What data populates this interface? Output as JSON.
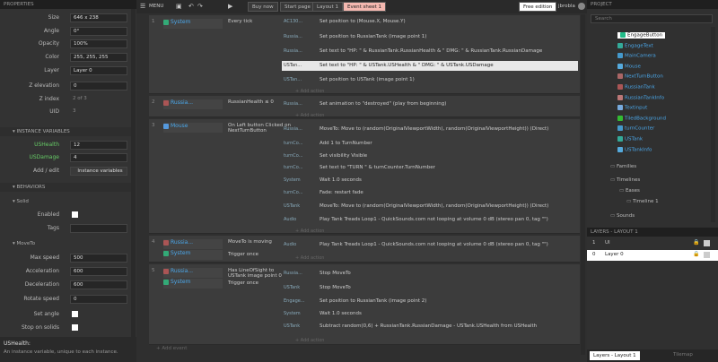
{
  "properties": {
    "header": "PROPERTIES",
    "rows": [
      {
        "label": "Size",
        "value": "646 x 238"
      },
      {
        "label": "Angle",
        "value": "0°"
      },
      {
        "label": "Opacity",
        "value": "100%"
      },
      {
        "label": "Color",
        "value": "255, 255, 255"
      },
      {
        "label": "Layer",
        "value": "Layer 0"
      },
      {
        "label": "Z elevation",
        "value": "0"
      },
      {
        "label": "Z index",
        "value": "2 of 3"
      },
      {
        "label": "UID",
        "value": "3"
      }
    ],
    "instance_vars_header": "INSTANCE VARIABLES",
    "instance_vars": [
      {
        "label": "USHealth",
        "value": "12"
      },
      {
        "label": "USDamage",
        "value": "4"
      }
    ],
    "add_edit_label": "Add / edit",
    "instance_vars_button": "Instance variables",
    "behaviors_header": "BEHAVIORS",
    "solid_label": "Solid",
    "enabled_label": "Enabled",
    "tags_label": "Tags",
    "moveto_label": "MoveTo",
    "moveto_rows": [
      {
        "label": "Max speed",
        "value": "500"
      },
      {
        "label": "Acceleration",
        "value": "600"
      },
      {
        "label": "Deceleration",
        "value": "600"
      },
      {
        "label": "Rotate speed",
        "value": "0"
      }
    ],
    "set_angle_label": "Set angle",
    "stop_on_solids_label": "Stop on solids",
    "help_title": "USHealth:",
    "help_text": "An instance variable, unique to each instance."
  },
  "toolbar": {
    "menu": "MENU",
    "buy_now": "Buy now",
    "start_page": "Start page",
    "layout_tab": "Layout 1",
    "event_tab": "Event sheet 1",
    "free_edition": "Free edition",
    "user": "jbrobla"
  },
  "events": [
    {
      "num": "1",
      "obj": "System",
      "cond": "Every tick",
      "actions": [
        {
          "obj": "AC130...",
          "text": "Set position to (Mouse.X, Mouse.Y)"
        },
        {
          "obj": "Russia...",
          "text": "Set position to RussianTank (image point 1)"
        },
        {
          "obj": "Russia...",
          "text": "Set text to \"HP: \" & RussianTank.RussianHealth & \" DMG: \" & RussianTank.RussianDamage"
        },
        {
          "obj": "USTan...",
          "text": "Set text to \"HP: \" & USTank.USHealth & \" DMG: \" & USTank.USDamage"
        },
        {
          "obj": "USTan...",
          "text": "Set position to USTank (image point 1)"
        }
      ]
    },
    {
      "num": "2",
      "obj": "Russia...",
      "cond": "RussianHealth ≤ 0",
      "actions": [
        {
          "obj": "Russia...",
          "text": "Set animation to \"destroyed\" (play from beginning)"
        }
      ]
    },
    {
      "num": "3",
      "obj": "Mouse",
      "cond": "On Left button Clicked on NextTurnButton",
      "actions": [
        {
          "obj": "Russia...",
          "text": "MoveTo: Move to (random(OriginalViewportWidth), random(OriginalViewportHeight)) (Direct)"
        },
        {
          "obj": "turnCo...",
          "text": "Add 1 to TurnNumber"
        },
        {
          "obj": "turnCo...",
          "text": "Set visibility Visible"
        },
        {
          "obj": "turnCo...",
          "text": "Set text to \"TURN \" & turnCounter.TurnNumber"
        },
        {
          "obj": "System",
          "text": "Wait 1.0 seconds"
        },
        {
          "obj": "turnCo...",
          "text": "Fade: restart fade"
        },
        {
          "obj": "USTank",
          "text": "MoveTo: Move to (random(OriginalViewportWidth), random(OriginalViewportHeight)) (Direct)"
        },
        {
          "obj": "Audio",
          "text": "Play Tank Treads Loop1 - QuickSounds.com not looping at volume 0 dB (stereo pan 0, tag \"\")"
        }
      ]
    },
    {
      "num": "4",
      "obj": "Russia...",
      "cond": "MoveTo is moving",
      "obj2": "System",
      "cond2": "Trigger once",
      "actions": [
        {
          "obj": "Audio",
          "text": "Play Tank Treads Loop1 - QuickSounds.com not looping at volume 0 dB (stereo pan 0, tag \"\")"
        }
      ]
    },
    {
      "num": "5",
      "obj": "Russia...",
      "cond": "Has LineOfSight to USTank image point 0",
      "obj2": "System",
      "cond2": "Trigger once",
      "actions": [
        {
          "obj": "Russia...",
          "text": "Stop MoveTo"
        },
        {
          "obj": "USTank",
          "text": "Stop MoveTo"
        },
        {
          "obj": "Engage...",
          "text": "Set position to RussianTank (image point 2)"
        },
        {
          "obj": "System",
          "text": "Wait 1.0 seconds"
        },
        {
          "obj": "USTank",
          "text": "Subtract random(0,6) + RussianTank.RussianDamage - USTank.USHealth from USHealth"
        }
      ]
    }
  ],
  "add_action": "+ Add action",
  "add_event": "Add event",
  "project": {
    "header": "PROJECT",
    "search_placeholder": "Search",
    "items": [
      "EngageButton",
      "EngageText",
      "MainCamera",
      "Mouse",
      "NextTurnButton",
      "RussianTank",
      "RussianTankInfo",
      "Textinput",
      "TiledBackground",
      "turnCounter",
      "USTank",
      "USTankInfo"
    ],
    "folders": [
      "Families",
      "Timelines",
      "Eases",
      "Timeline 1",
      "Sounds"
    ]
  },
  "layers": {
    "header": "LAYERS - LAYOUT 1",
    "rows": [
      {
        "num": "1",
        "name": "UI"
      },
      {
        "num": "0",
        "name": "Layer 0"
      }
    ],
    "tab_active": "Layers - Layout 1",
    "tab_other": "Tilemap"
  }
}
